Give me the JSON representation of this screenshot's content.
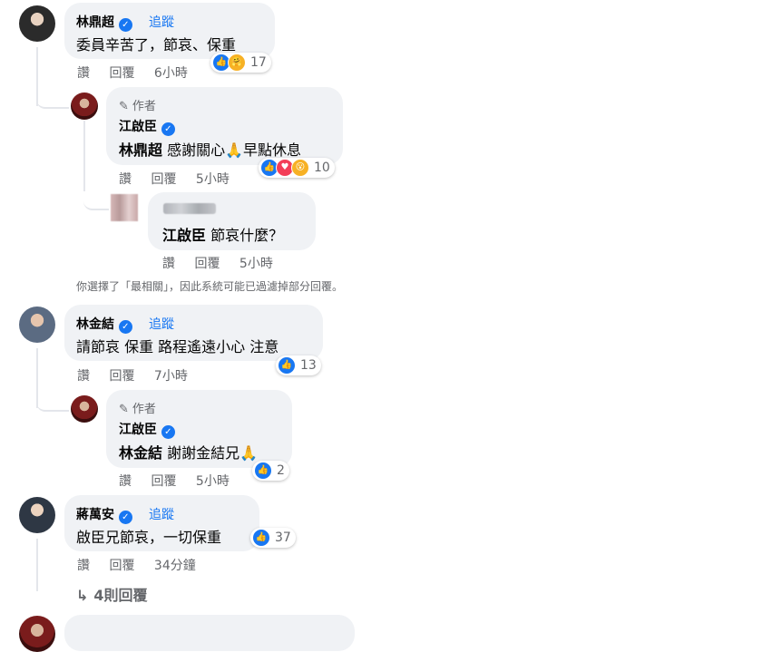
{
  "follow_label": "追蹤",
  "author_label": "作者",
  "actions": {
    "like": "讚",
    "reply": "回覆"
  },
  "comments": [
    {
      "name": "林鼎超",
      "text": "委員辛苦了，節哀、保重",
      "time": "6小時",
      "reactions": {
        "icons": [
          "like-icon",
          "care-icon"
        ],
        "count": "17"
      },
      "reply": {
        "name": "江啟臣",
        "mention": "林鼎超",
        "text": "感謝關心🙏早點休息",
        "time": "5小時",
        "reactions": {
          "icons": [
            "like-icon",
            "love-icon",
            "wow-icon"
          ],
          "count": "10"
        }
      },
      "reply2": {
        "mention": "江啟臣",
        "text": "節哀什麼？",
        "time": "5小時"
      }
    },
    {
      "name": "林金結",
      "text": "請節哀 保重 路程遙遠小心 注意",
      "time": "7小時",
      "reactions": {
        "icons": [
          "like-icon"
        ],
        "count": "13"
      },
      "reply": {
        "name": "江啟臣",
        "mention": "林金結",
        "text": "謝謝金結兄🙏",
        "time": "5小時",
        "reactions": {
          "icons": [
            "like-icon"
          ],
          "count": "2"
        }
      }
    },
    {
      "name": "蔣萬安",
      "text": "啟臣兄節哀，一切保重",
      "time": "34分鐘",
      "reactions": {
        "icons": [
          "like-icon"
        ],
        "count": "37"
      },
      "more_replies": "4則回覆"
    }
  ],
  "filter_note": "你選擇了「最相關」，因此系統可能已過濾掉部分回覆。",
  "colors": {
    "accent": "#1877f2",
    "bubble": "#f0f2f5",
    "muted": "#65676b"
  }
}
